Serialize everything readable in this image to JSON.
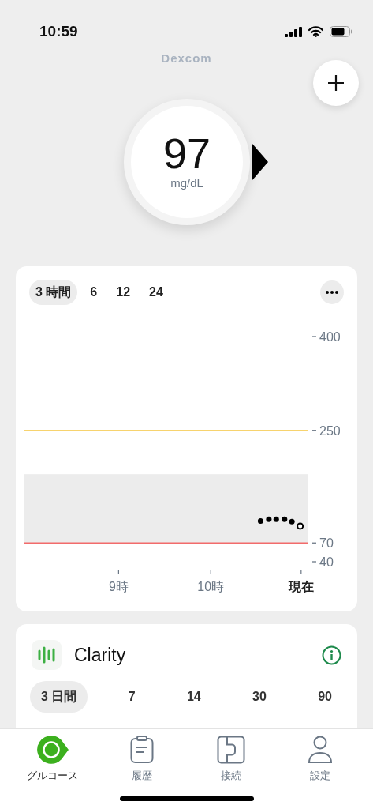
{
  "status_bar": {
    "time": "10:59"
  },
  "header": {
    "logo": "Dexcom"
  },
  "reading": {
    "value": "97",
    "unit": "mg/dL"
  },
  "graph_card": {
    "ranges": [
      {
        "label": "3 時間",
        "selected": true
      },
      {
        "label": "6",
        "selected": false
      },
      {
        "label": "12",
        "selected": false
      },
      {
        "label": "24",
        "selected": false
      }
    ],
    "chart_data": {
      "type": "scatter",
      "xlim": [
        7.97,
        11.05
      ],
      "ylim": [
        40,
        400
      ],
      "x": [
        10.54,
        10.63,
        10.71,
        10.8,
        10.88,
        10.97
      ],
      "series": [
        {
          "color": "#000000",
          "values": [
            105,
            108,
            108,
            108,
            104,
            97
          ]
        }
      ],
      "xticks": [
        {
          "value": 9,
          "label": "9時"
        },
        {
          "value": 10,
          "label": "10時"
        },
        {
          "value": 10.98,
          "label": "現在"
        }
      ],
      "yticks": [
        400,
        250,
        70,
        40
      ],
      "bands": [
        {
          "axis": "y",
          "from": 70,
          "to": 180,
          "color": "#ececec"
        }
      ],
      "ref_lines": [
        {
          "axis": "y",
          "value": 250,
          "color": "#f7d36e"
        },
        {
          "axis": "y",
          "value": 70,
          "color": "#f26b6b"
        }
      ]
    }
  },
  "clarity_card": {
    "title": "Clarity",
    "ranges": [
      {
        "label": "3 日間",
        "selected": true
      },
      {
        "label": "7",
        "selected": false
      },
      {
        "label": "14",
        "selected": false
      },
      {
        "label": "30",
        "selected": false
      },
      {
        "label": "90",
        "selected": false
      }
    ]
  },
  "tab_bar": [
    {
      "label": "グルコース",
      "selected": true
    },
    {
      "label": "履歴",
      "selected": false
    },
    {
      "label": "接続",
      "selected": false
    },
    {
      "label": "設定",
      "selected": false
    }
  ]
}
